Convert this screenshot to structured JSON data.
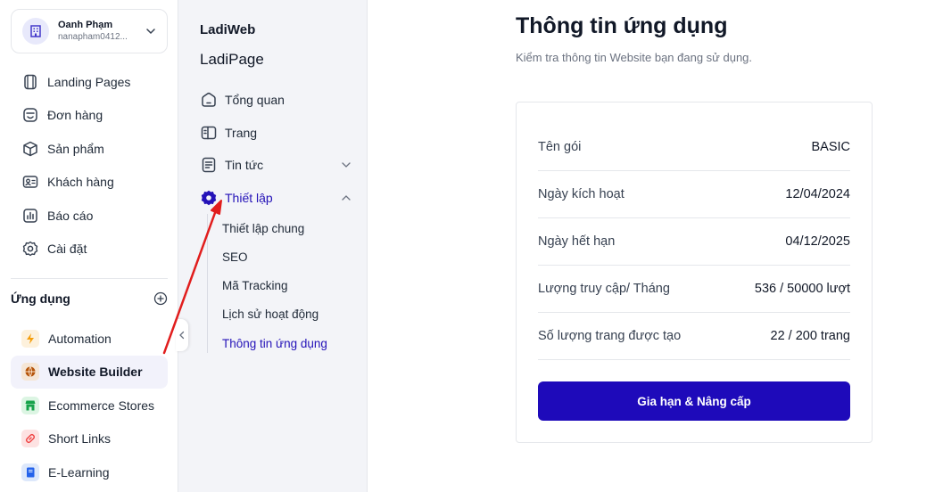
{
  "account": {
    "name": "Oanh Phạm",
    "email": "nanapham0412..."
  },
  "nav": {
    "items": [
      {
        "label": "Landing Pages",
        "icon": "landing-pages-icon"
      },
      {
        "label": "Đơn hàng",
        "icon": "orders-icon"
      },
      {
        "label": "Sản phẩm",
        "icon": "products-icon"
      },
      {
        "label": "Khách hàng",
        "icon": "customers-icon"
      },
      {
        "label": "Báo cáo",
        "icon": "report-icon"
      },
      {
        "label": "Cài đặt",
        "icon": "gear-icon"
      }
    ]
  },
  "apps": {
    "title": "Ứng dụng",
    "items": [
      {
        "label": "Automation",
        "icon": "lightning-icon",
        "color": "#f59e0b"
      },
      {
        "label": "Website Builder",
        "icon": "globe-icon",
        "color": "#b45309",
        "active": true
      },
      {
        "label": "Ecommerce Stores",
        "icon": "store-icon",
        "color": "#16a34a"
      },
      {
        "label": "Short Links",
        "icon": "link-icon",
        "color": "#ef4444"
      },
      {
        "label": "E-Learning",
        "icon": "book-icon",
        "color": "#2563eb"
      }
    ]
  },
  "sub": {
    "brand": "LadiWeb",
    "site": "LadiPage",
    "items": [
      {
        "label": "Tổng quan",
        "icon": "home-icon"
      },
      {
        "label": "Trang",
        "icon": "page-icon"
      },
      {
        "label": "Tin tức",
        "icon": "news-icon"
      },
      {
        "label": "Thiết lập",
        "icon": "gear-icon"
      }
    ],
    "children": [
      {
        "label": "Thiết lập chung"
      },
      {
        "label": "SEO"
      },
      {
        "label": "Mã Tracking"
      },
      {
        "label": "Lịch sử hoạt động"
      },
      {
        "label": "Thông tin ứng dụng",
        "active": true
      }
    ]
  },
  "main": {
    "title": "Thông tin ứng dụng",
    "subtitle": "Kiểm tra thông tin Website bạn đang sử dụng.",
    "rows": [
      {
        "label": "Tên gói",
        "value": "BASIC"
      },
      {
        "label": "Ngày kích hoạt",
        "value": "12/04/2024"
      },
      {
        "label": "Ngày hết hạn",
        "value": "04/12/2025"
      },
      {
        "label": "Lượng truy cập/ Tháng",
        "value": "536 / 50000 lượt"
      },
      {
        "label": "Số lượng trang được tạo",
        "value": "22 / 200 trang"
      }
    ],
    "cta": "Gia hạn & Nâng cấp"
  },
  "colors": {
    "accent": "#1e0aba",
    "active_text": "#2412b8",
    "annotation": "#e11d1d"
  }
}
